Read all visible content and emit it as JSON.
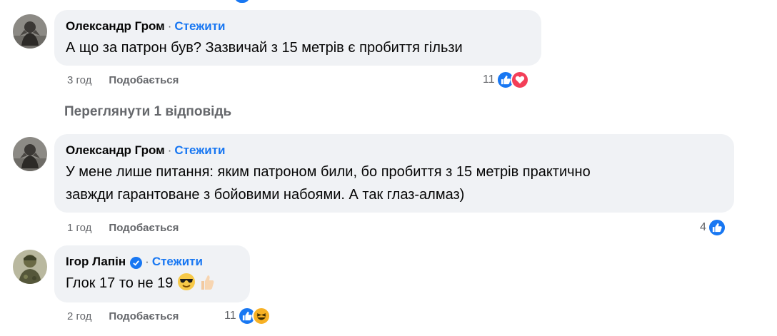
{
  "comments": [
    {
      "author": "Олександр Гром",
      "follow_label": "Стежити",
      "separator": "·",
      "text": "А що за патрон був? Зазвичай з 15 метрів є пробиття гільзи",
      "time": "3 год",
      "like_label": "Подобається",
      "reaction_count": "11",
      "reactions": [
        "like-icon",
        "love-icon"
      ]
    },
    {
      "author": "Олександр Гром",
      "follow_label": "Стежити",
      "separator": "·",
      "text_line1": "У мене лише питання: яким патроном били, бо пробиття з 15 метрів практично",
      "text_line2": "завжди гарантоване з бойовими набоями. А так глаз-алмаз)",
      "time": "1 год",
      "like_label": "Подобається",
      "reaction_count": "4",
      "reactions": [
        "like-icon"
      ]
    },
    {
      "author": "Ігор Лапін",
      "follow_label": "Стежити",
      "separator": "·",
      "verified": true,
      "text": "Глок 17 то не 19",
      "emojis": [
        "sunglasses-emoji",
        "thumbs-up-emoji"
      ],
      "time": "2 год",
      "like_label": "Подобається",
      "reaction_count": "11",
      "reactions": [
        "like-icon",
        "haha-icon"
      ]
    }
  ],
  "view_replies_label": "Переглянути 1 відповідь",
  "colors": {
    "bubble": "#f0f2f5",
    "link": "#1877f2",
    "meta": "#65676b",
    "love": "#f33e58",
    "haha": "#f7b125"
  }
}
